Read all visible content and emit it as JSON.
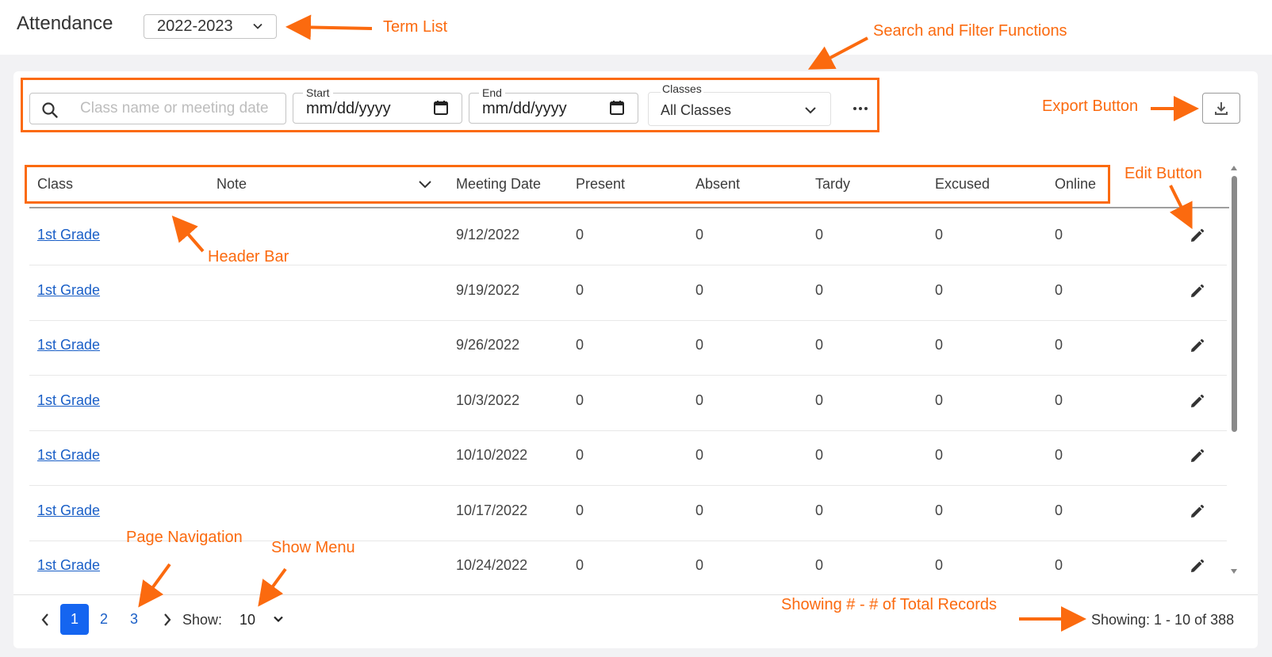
{
  "header": {
    "title": "Attendance",
    "term_value": "2022-2023"
  },
  "filters": {
    "search_placeholder": "Class name or meeting date",
    "start_label": "Start",
    "start_value": "mm/dd/yyyy",
    "end_label": "End",
    "end_value": "mm/dd/yyyy",
    "classes_label": "Classes",
    "classes_value": "All Classes"
  },
  "table": {
    "columns": [
      "Class",
      "Note",
      "Meeting Date",
      "Present",
      "Absent",
      "Tardy",
      "Excused",
      "Online"
    ],
    "rows": [
      {
        "class": "1st Grade",
        "note": "",
        "date": "9/12/2022",
        "present": "0",
        "absent": "0",
        "tardy": "0",
        "excused": "0",
        "online": "0"
      },
      {
        "class": "1st Grade",
        "note": "",
        "date": "9/19/2022",
        "present": "0",
        "absent": "0",
        "tardy": "0",
        "excused": "0",
        "online": "0"
      },
      {
        "class": "1st Grade",
        "note": "",
        "date": "9/26/2022",
        "present": "0",
        "absent": "0",
        "tardy": "0",
        "excused": "0",
        "online": "0"
      },
      {
        "class": "1st Grade",
        "note": "",
        "date": "10/3/2022",
        "present": "0",
        "absent": "0",
        "tardy": "0",
        "excused": "0",
        "online": "0"
      },
      {
        "class": "1st Grade",
        "note": "",
        "date": "10/10/2022",
        "present": "0",
        "absent": "0",
        "tardy": "0",
        "excused": "0",
        "online": "0"
      },
      {
        "class": "1st Grade",
        "note": "",
        "date": "10/17/2022",
        "present": "0",
        "absent": "0",
        "tardy": "0",
        "excused": "0",
        "online": "0"
      },
      {
        "class": "1st Grade",
        "note": "",
        "date": "10/24/2022",
        "present": "0",
        "absent": "0",
        "tardy": "0",
        "excused": "0",
        "online": "0"
      }
    ]
  },
  "pagination": {
    "pages": [
      "1",
      "2",
      "3"
    ],
    "active_page": "1",
    "show_label": "Show:",
    "show_value": "10",
    "showing_text": "Showing: 1 - 10 of 388"
  },
  "annotations": {
    "term_list": "Term List",
    "search_filter": "Search and Filter Functions",
    "export_button": "Export Button",
    "edit_button": "Edit Button",
    "header_bar": "Header Bar",
    "page_navigation": "Page Navigation",
    "show_menu": "Show Menu",
    "showing_records": "Showing # - # of Total Records"
  },
  "colors": {
    "annotation": "#fb6a0f",
    "link": "#1a5fc7",
    "active_page": "#1565f0",
    "background": "#f2f2f4"
  },
  "icons": [
    "search-icon",
    "calendar-icon",
    "chevron-down-icon",
    "more-icon",
    "download-icon",
    "pencil-icon",
    "chevron-left-icon",
    "chevron-right-icon"
  ]
}
